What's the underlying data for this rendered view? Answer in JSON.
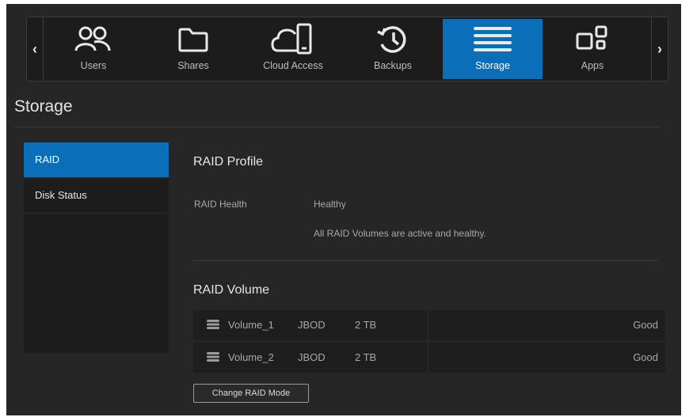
{
  "nav": {
    "items": [
      {
        "label": "Users",
        "icon": "users-icon"
      },
      {
        "label": "Shares",
        "icon": "folder-icon"
      },
      {
        "label": "Cloud Access",
        "icon": "cloud-device-icon"
      },
      {
        "label": "Backups",
        "icon": "backup-history-icon"
      },
      {
        "label": "Storage",
        "icon": "storage-icon",
        "active": true
      },
      {
        "label": "Apps",
        "icon": "apps-icon"
      }
    ],
    "left_arrow": "‹",
    "right_arrow": "›"
  },
  "page": {
    "title": "Storage"
  },
  "sidebar": {
    "items": [
      {
        "label": "RAID",
        "active": true
      },
      {
        "label": "Disk Status"
      }
    ]
  },
  "raid_profile": {
    "title": "RAID Profile",
    "health_label": "RAID Health",
    "health_value": "Healthy",
    "health_detail": "All RAID Volumes are active and healthy."
  },
  "raid_volume": {
    "title": "RAID Volume",
    "volumes": [
      {
        "name": "Volume_1",
        "type": "JBOD",
        "size": "2 TB",
        "status": "Good"
      },
      {
        "name": "Volume_2",
        "type": "JBOD",
        "size": "2 TB",
        "status": "Good"
      }
    ]
  },
  "actions": {
    "change_raid_mode": "Change RAID Mode"
  },
  "colors": {
    "accent": "#0a6fb8",
    "background": "#262626",
    "panel": "#1d1d1d"
  }
}
